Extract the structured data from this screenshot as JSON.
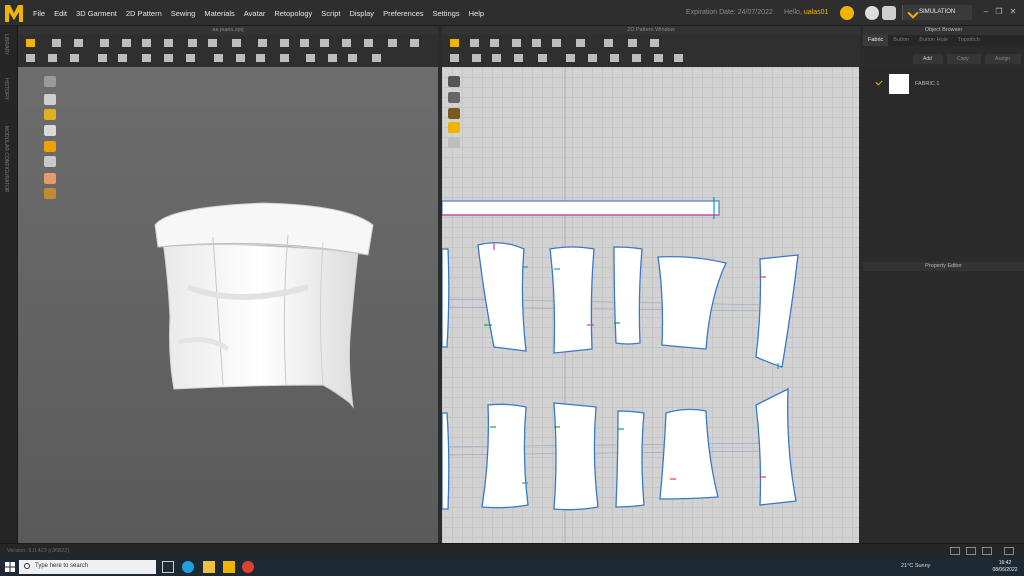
{
  "menu": [
    "File",
    "Edit",
    "3D Garment",
    "2D Pattern",
    "Sewing",
    "Materials",
    "Avatar",
    "Retopology",
    "Script",
    "Display",
    "Preferences",
    "Settings",
    "Help"
  ],
  "header": {
    "expiration": "Expiration Date: 24/07/2022",
    "hello_prefix": "Hello,",
    "username": "ualas01",
    "simulation_label": "SIMULATION"
  },
  "side_tabs": [
    "LIBRARY",
    "HISTORY",
    "MODULAR CONFIGURATOR"
  ],
  "window3d": {
    "title": "aa jeans.zprj"
  },
  "window2d": {
    "title": "2D Pattern Window"
  },
  "object_browser": {
    "title": "Object Browser",
    "tabs": [
      "Fabric",
      "Button",
      "Button Hole",
      "Topstitch"
    ],
    "actions": {
      "add": "Add",
      "copy": "Copy",
      "assign": "Assign"
    },
    "items": [
      {
        "name": "FABRIC 1"
      }
    ]
  },
  "property_editor": {
    "title": "Property Editor"
  },
  "status": {
    "version": "Version: 6.0.423 (r36822)"
  },
  "taskbar": {
    "search_placeholder": "Type here to search",
    "weather": "21°C  Sunny",
    "time": "16:42",
    "date": "08/06/2022"
  },
  "colors": {
    "accent": "#f0b400",
    "panel": "#2b2b2b",
    "grid": "#d2d2d2"
  }
}
